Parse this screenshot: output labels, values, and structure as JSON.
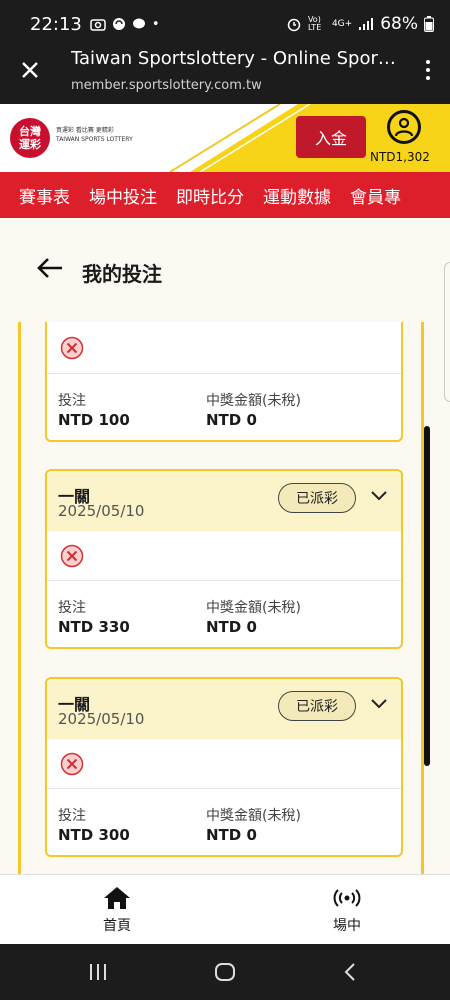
{
  "status_bar": {
    "time": "22:13",
    "battery": "68%",
    "network_labels": [
      "Vo) LTE",
      "4G+"
    ]
  },
  "browser": {
    "title": "Taiwan Sportslottery - Online Sports...",
    "url": "member.sportslottery.com.tw"
  },
  "header": {
    "logo_text": "台灣運彩",
    "logo_slogan_line1": "買運彩 看比賽 更精彩",
    "logo_slogan_line2": "TAIWAN SPORTS LOTTERY",
    "deposit_label": "入金",
    "balance": "NTD1,302",
    "colors": {
      "brand_red": "#dc1f2a",
      "accent_yellow": "#f3c829"
    }
  },
  "nav": {
    "items": [
      "賽事表",
      "場中投注",
      "即時比分",
      "運動數據",
      "會員專"
    ]
  },
  "page": {
    "back_icon": "arrow-left-icon",
    "title": "我的投注"
  },
  "bets": [
    {
      "partial": true,
      "result_icon": "loss-x-icon",
      "stake_label": "投注",
      "stake_value": "NTD 100",
      "payout_label": "中獎金額(未稅)",
      "payout_value": "NTD 0"
    },
    {
      "type": "一關",
      "date": "2025/05/10",
      "status": "已派彩",
      "result_icon": "loss-x-icon",
      "stake_label": "投注",
      "stake_value": "NTD 330",
      "payout_label": "中獎金額(未稅)",
      "payout_value": "NTD 0"
    },
    {
      "type": "一關",
      "date": "2025/05/10",
      "status": "已派彩",
      "result_icon": "loss-x-icon",
      "stake_label": "投注",
      "stake_value": "NTD 300",
      "payout_label": "中獎金額(未稅)",
      "payout_value": "NTD 0"
    }
  ],
  "bottom_nav": {
    "home_label": "首頁",
    "live_label": "場中"
  }
}
